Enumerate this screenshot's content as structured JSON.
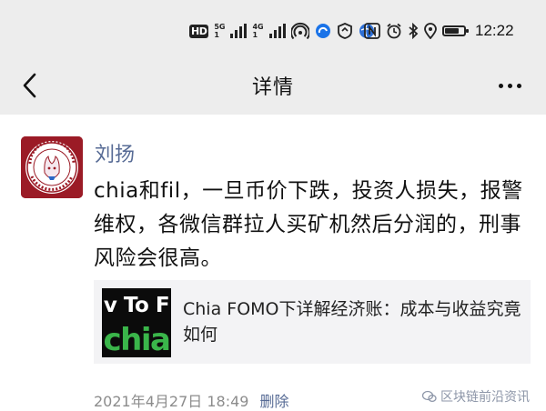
{
  "status_bar": {
    "hd_label": "HD",
    "network_a": {
      "top": "5G",
      "bottom": "1"
    },
    "network_b": {
      "top": "4G",
      "bottom": "1"
    },
    "time": "12:22",
    "battery_level_percent": 75
  },
  "nav": {
    "title": "详情"
  },
  "post": {
    "author": "刘扬",
    "text": "chia和fil，一旦币价下跌，投资人损失，报警维权，各微信群拉人买矿机然后分润的，刑事风险会很高。",
    "link_card": {
      "thumb_top": "v To F",
      "thumb_bottom": "chia",
      "title": "Chia FOMO下详解经济账：成本与收益究竟如何"
    },
    "timestamp": "2021年4月27日 18:49",
    "delete_label": "删除"
  },
  "watermark": "区块链前沿资讯"
}
